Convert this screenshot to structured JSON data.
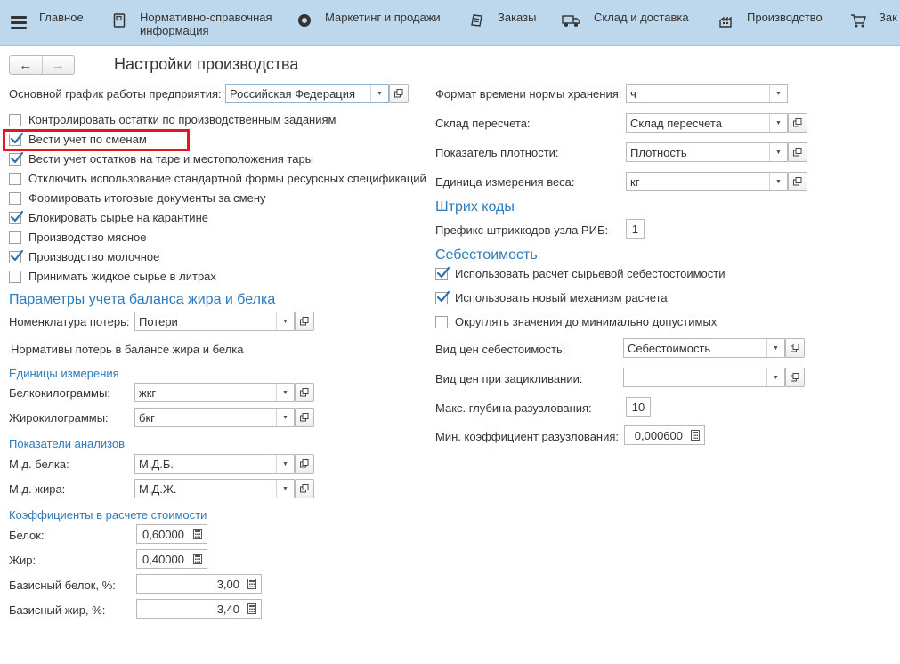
{
  "menu": [
    {
      "label": "Главное",
      "icon": "burger-icon"
    },
    {
      "label": "Нормативно-справочная информация",
      "icon": "reference-book-icon"
    },
    {
      "label": "Маркетинг и продажи",
      "icon": "marketing-icon"
    },
    {
      "label": "Заказы",
      "icon": "orders-icon"
    },
    {
      "label": "Склад и доставка",
      "icon": "truck-icon"
    },
    {
      "label": "Производство",
      "icon": "factory-icon"
    },
    {
      "label": "Зак",
      "icon": "cart-icon"
    }
  ],
  "toolbar": {
    "back": "←",
    "forward": "→",
    "title": "Настройки производства"
  },
  "left": {
    "schedule_label": "Основной график работы предприятия:",
    "schedule_value": "Российская Федерация",
    "checkboxes": [
      {
        "label": "Контролировать остатки по производственным заданиям",
        "checked": false
      },
      {
        "label": "Вести учет по сменам",
        "checked": true
      },
      {
        "label": "Вести учет остатков на таре и местоположения тары",
        "checked": true
      },
      {
        "label": "Отключить использование стандартной формы ресурсных спецификаций",
        "checked": false
      },
      {
        "label": "Формировать итоговые документы за смену",
        "checked": false
      },
      {
        "label": "Блокировать сырье на карантине",
        "checked": true
      },
      {
        "label": "Производство мясное",
        "checked": false
      },
      {
        "label": "Производство молочное",
        "checked": true
      },
      {
        "label": "Принимать жидкое сырье в литрах",
        "checked": false
      }
    ],
    "fat_section": "Параметры учета баланса жира и белка",
    "loss_label": "Номенклатура потерь:",
    "loss_value": "Потери",
    "loss_norms": "Нормативы потерь в балансе жира и белка",
    "units_section": "Единицы измерения",
    "protein_kg_label": "Белкокилограммы:",
    "protein_kg_value": "жкг",
    "fat_kg_label": "Жирокилограммы:",
    "fat_kg_value": "бкг",
    "analysis_section": "Показатели анализов",
    "md_protein_label": "М.д. белка:",
    "md_protein_value": "М.Д.Б.",
    "md_fat_label": "М.д. жира:",
    "md_fat_value": "М.Д.Ж.",
    "coef_section": "Коэффициенты в расчете стоимости",
    "protein_label": "Белок:",
    "protein_value": "0,60000",
    "fat_label": "Жир:",
    "fat_value": "0,40000",
    "base_protein_label": "Базисный белок, %:",
    "base_protein_value": "3,00",
    "base_fat_label": "Базисный жир, %:",
    "base_fat_value": "3,40"
  },
  "right": {
    "storage_format_label": "Формат времени нормы хранения:",
    "storage_format_value": "ч",
    "recount_wh_label": "Склад пересчета:",
    "recount_wh_value": "Склад пересчета",
    "density_label": "Показатель плотности:",
    "density_value": "Плотность",
    "weight_unit_label": "Единица измерения веса:",
    "weight_unit_value": "кг",
    "barcodes_section": "Штрих коды",
    "barcode_prefix_label": "Префикс штрихкодов узла РИБ:",
    "barcode_prefix_value": "1",
    "cost_section": "Себестоимость",
    "cost_checkboxes": [
      {
        "label": "Использовать расчет сырьевой себестостоимости",
        "checked": true
      },
      {
        "label": "Использовать новый механизм расчета",
        "checked": true
      },
      {
        "label": "Округлять значения до минимально допустимых",
        "checked": false
      }
    ],
    "cost_price_label": "Вид цен себестоимость:",
    "cost_price_value": "Себестоимость",
    "loop_price_label": "Вид цен при зацикливании:",
    "loop_price_value": "",
    "max_depth_label": "Макс. глубина разузлования:",
    "max_depth_value": "10",
    "min_coef_label": "Мин. коэффициент разузлования:",
    "min_coef_value": "0,000600"
  },
  "colors": {
    "accent": "#2c7bbf",
    "menubar": "#bdd8ec",
    "highlight": "#e8141e"
  }
}
